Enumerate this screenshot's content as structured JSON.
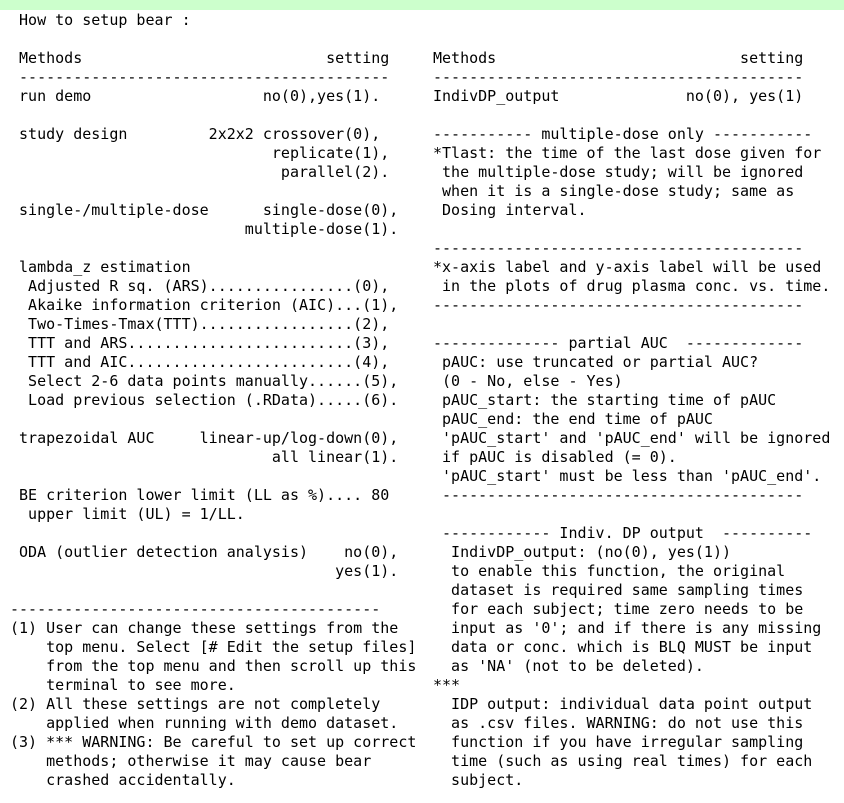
{
  "window": {
    "title": "How to setup bear :"
  },
  "left_pane": {
    "lines": [
      " How to setup bear :",
      "",
      " Methods                           setting",
      " -----------------------------------------",
      " run demo                   no(0),yes(1).",
      "",
      " study design         2x2x2 crossover(0),",
      "                             replicate(1),",
      "                              parallel(2).",
      "",
      " single-/multiple-dose      single-dose(0),",
      "                          multiple-dose(1).",
      "",
      " lambda_z estimation",
      "  Adjusted R sq. (ARS)................(0),",
      "  Akaike information criterion (AIC)...(1),",
      "  Two-Times-Tmax(TTT).................(2),",
      "  TTT and ARS.........................(3),",
      "  TTT and AIC.........................(4),",
      "  Select 2-6 data points manually......(5),",
      "  Load previous selection (.RData).....(6).",
      "",
      " trapezoidal AUC     linear-up/log-down(0),",
      "                             all linear(1).",
      "",
      " BE criterion lower limit (LL as %).... 80",
      "  upper limit (UL) = 1/LL.",
      "",
      " ODA (outlier detection analysis)    no(0),",
      "                                    yes(1).",
      "",
      "-----------------------------------------",
      "(1) User can change these settings from the",
      "    top menu. Select [# Edit the setup files]",
      "    from the top menu and then scroll up this",
      "    terminal to see more.",
      "(2) All these settings are not completely",
      "    applied when running with demo dataset.",
      "(3) *** WARNING: Be careful to set up correct",
      "    methods; otherwise it may cause bear",
      "    crashed accidentally."
    ]
  },
  "right_pane": {
    "lines": [
      "",
      "",
      "Methods                           setting",
      "-----------------------------------------",
      "IndivDP_output              no(0), yes(1)",
      "",
      "----------- multiple-dose only -----------",
      "*Tlast: the time of the last dose given for",
      " the multiple-dose study; will be ignored",
      " when it is a single-dose study; same as",
      " Dosing interval.",
      "",
      "-----------------------------------------",
      "*x-axis label and y-axis label will be used",
      " in the plots of drug plasma conc. vs. time.",
      "-----------------------------------------",
      "",
      "-------------- partial AUC  -------------",
      " pAUC: use truncated or partial AUC?",
      " (0 - No, else - Yes)",
      " pAUC_start: the starting time of pAUC",
      " pAUC_end: the end time of pAUC",
      " 'pAUC_start' and 'pAUC_end' will be ignored",
      " if pAUC is disabled (= 0).",
      " 'pAUC_start' must be less than 'pAUC_end'.",
      " ----------------------------------------",
      "",
      " ------------ Indiv. DP output  ----------",
      "  IndivDP_output: (no(0), yes(1))",
      "  to enable this function, the original",
      "  dataset is required same sampling times",
      "  for each subject; time zero needs to be",
      "  input as '0'; and if there is any missing",
      "  data or conc. which is BLQ MUST be input",
      "  as 'NA' (not to be deleted).",
      "***",
      "  IDP output: individual data point output",
      "  as .csv files. WARNING: do not use this",
      "  function if you have irregular sampling",
      "  time (such as using real times) for each",
      "  subject."
    ]
  },
  "colors": {
    "top_bar": "#ccffcc",
    "background": "#ffffff",
    "text": "#000000"
  }
}
